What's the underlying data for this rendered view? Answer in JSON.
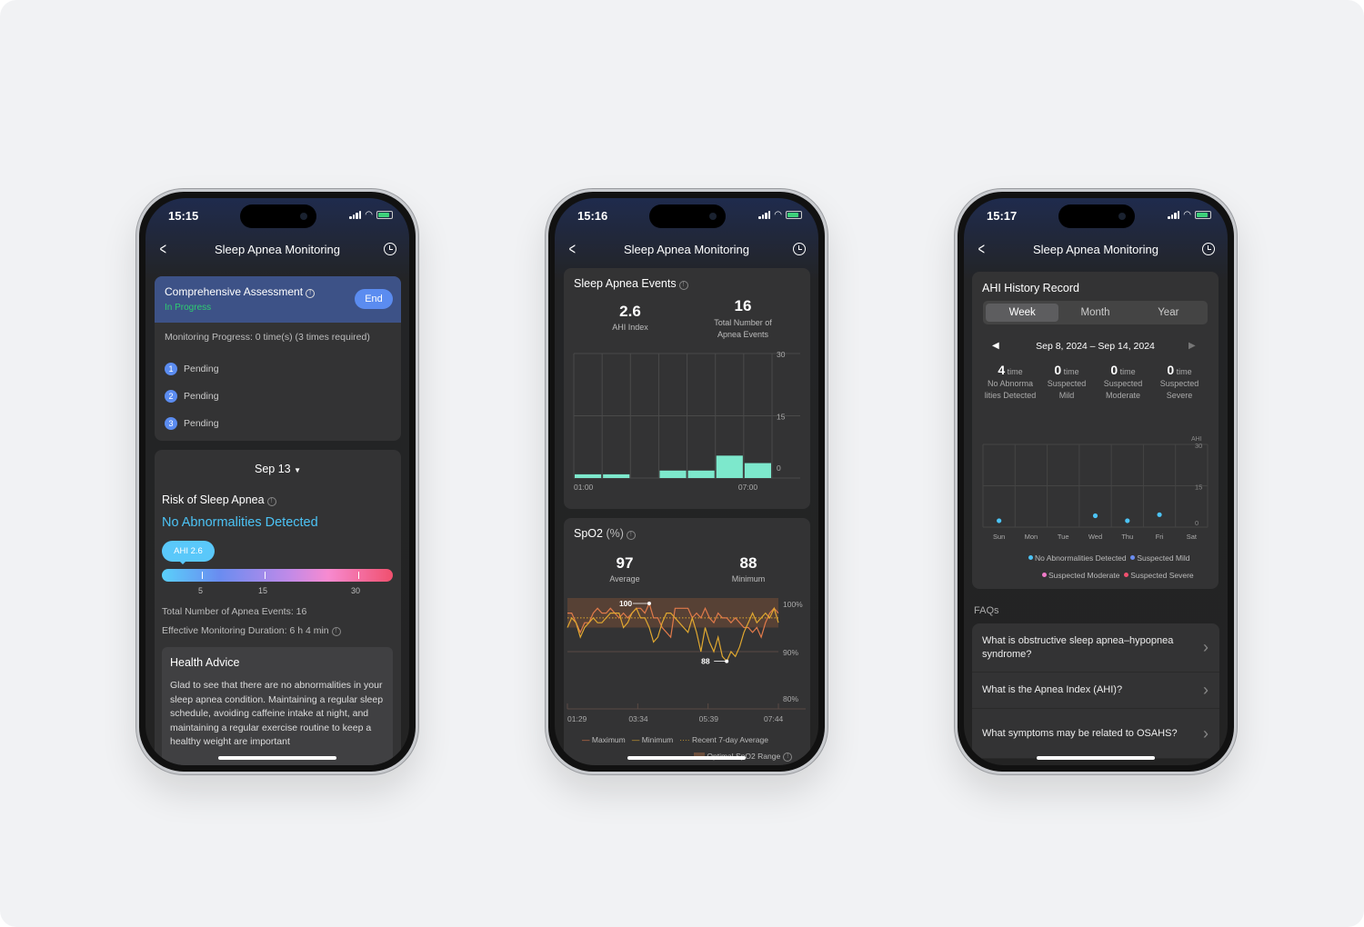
{
  "common": {
    "title": "Sleep Apnea Monitoring"
  },
  "screen1": {
    "time": "15:15",
    "assessment": {
      "title": "Comprehensive Assessment",
      "status": "In Progress",
      "end_button": "End",
      "progress": "Monitoring Progress: 0 time(s) (3 times required)",
      "steps": [
        {
          "n": "1",
          "label": "Pending"
        },
        {
          "n": "2",
          "label": "Pending"
        },
        {
          "n": "3",
          "label": "Pending"
        }
      ]
    },
    "date": "Sep 13",
    "risk_title": "Risk of Sleep Apnea",
    "risk_result": "No Abnormalities Detected",
    "ahi_badge": "AHI 2.6",
    "ahi_value": 2.6,
    "scale_ticks": [
      "5",
      "15",
      "30"
    ],
    "total_events": "Total Number of Apnea Events: 16",
    "duration": "Effective Monitoring Duration: 6 h 4 min",
    "advice_title": "Health Advice",
    "advice_text": "Glad to see that there are no abnormalities in your sleep apnea condition. Maintaining a regular sleep schedule, avoiding caffeine intake at night, and maintaining a regular exercise routine to keep a healthy weight are important"
  },
  "screen2": {
    "time": "15:16",
    "events_title": "Sleep Apnea Events",
    "ahi_value": "2.6",
    "ahi_label": "AHI Index",
    "total_value": "16",
    "total_label": "Total Number of Apnea Events",
    "spo2_title": "SpO2",
    "spo2_unit": "(%)",
    "avg_value": "97",
    "avg_label": "Average",
    "min_value": "88",
    "min_label": "Minimum",
    "legend": [
      "Maximum",
      "Minimum",
      "Recent 7-day Average",
      "Optimal SpO2 Range"
    ]
  },
  "screen3": {
    "time": "15:17",
    "history_title": "AHI History Record",
    "tabs": [
      "Week",
      "Month",
      "Year"
    ],
    "active_tab": "Week",
    "date_range": "Sep 8, 2024 – Sep 14, 2024",
    "stats": [
      {
        "value": "4",
        "unit": "time",
        "label": "No Abnorma lities Detected"
      },
      {
        "value": "0",
        "unit": "time",
        "label": "Suspected Mild"
      },
      {
        "value": "0",
        "unit": "time",
        "label": "Suspected Moderate"
      },
      {
        "value": "0",
        "unit": "time",
        "label": "Suspected Severe"
      }
    ],
    "faq_title": "FAQs",
    "faqs": [
      "What is obstructive sleep apnea–hypopnea syndrome?",
      "What is the Apnea Index (AHI)?",
      "What symptoms may be related to OSAHS?"
    ]
  },
  "colors": {
    "accent": "#5b8cf0",
    "in_progress": "#2ecc71",
    "result": "#4cc3f5",
    "bar": "#7de8cc",
    "max_line": "#e07a4a",
    "min_line": "#e0a830",
    "none": "#4cc3f5",
    "mild": "#6a8cf0",
    "moderate": "#f07ac8",
    "severe": "#f0506e"
  },
  "chart_data": [
    {
      "type": "bar",
      "title": "Sleep Apnea Events",
      "x_ticks": [
        "01:00",
        "07:00"
      ],
      "y_ticks": [
        "0",
        "15",
        "30"
      ],
      "ylim": [
        0,
        30
      ],
      "values": [
        1,
        1,
        0,
        2,
        2,
        6,
        4
      ],
      "grid": true
    },
    {
      "type": "line",
      "title": "SpO2 (%)",
      "x_ticks": [
        "01:29",
        "03:34",
        "05:39",
        "07:44"
      ],
      "y_ticks": [
        "80%",
        "90%",
        "100%"
      ],
      "ylim": [
        80,
        100
      ],
      "grid": true,
      "series": [
        {
          "name": "Maximum",
          "values": [
            98,
            98,
            96,
            94,
            96,
            96,
            98,
            99,
            98,
            98,
            99,
            98,
            97,
            98,
            97,
            98,
            99,
            99,
            98,
            100,
            97,
            97,
            95,
            94,
            93,
            99,
            99,
            99,
            99,
            97,
            98,
            97,
            99,
            97,
            96,
            98,
            97,
            97,
            96,
            97,
            96,
            95,
            95,
            94,
            95,
            93,
            96,
            98,
            99,
            98
          ]
        },
        {
          "name": "Minimum",
          "values": [
            95,
            97,
            96,
            93,
            95,
            96,
            97,
            96,
            96,
            97,
            98,
            98,
            98,
            95,
            96,
            98,
            99,
            97,
            97,
            95,
            92,
            93,
            96,
            98,
            98,
            97,
            96,
            95,
            94,
            97,
            94,
            90,
            95,
            92,
            90,
            93,
            89,
            88,
            90,
            89,
            91,
            94,
            96,
            98,
            96,
            97,
            98,
            97,
            99,
            96
          ]
        }
      ],
      "average": 97,
      "optimal_range": [
        95,
        100
      ],
      "annotations": [
        {
          "label": "100",
          "value": 100
        },
        {
          "label": "88",
          "value": 88
        }
      ]
    },
    {
      "type": "scatter",
      "title": "AHI History Record",
      "ylabel": "AHI",
      "categories": [
        "Sun",
        "Mon",
        "Tue",
        "Wed",
        "Thu",
        "Fri",
        "Sat"
      ],
      "values": [
        1,
        null,
        null,
        2.8,
        1,
        3.2,
        null
      ],
      "y_ticks": [
        "0",
        "15",
        "30"
      ],
      "ylim": [
        0,
        30
      ],
      "legend": [
        "No Abnormalities Detected",
        "Suspected Mild",
        "Suspected Moderate",
        "Suspected Severe"
      ],
      "legend_position": "bottom"
    }
  ]
}
